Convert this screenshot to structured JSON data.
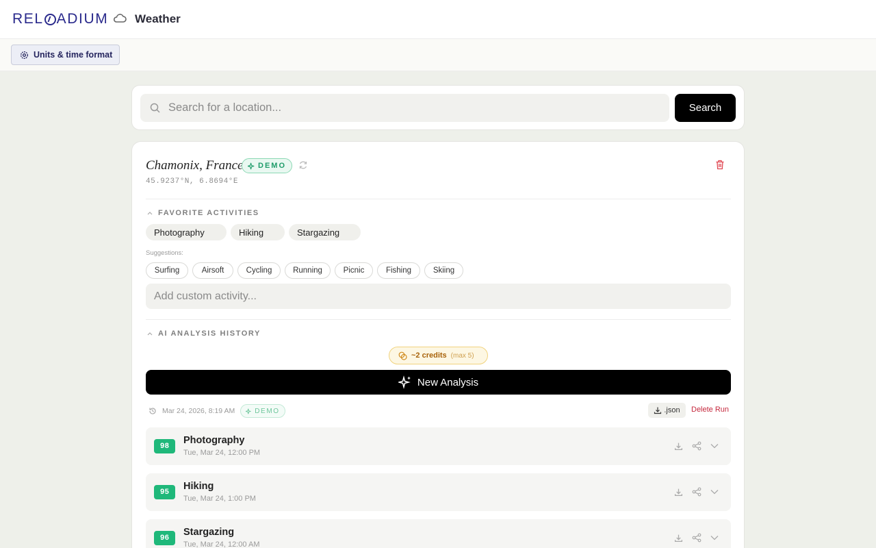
{
  "header": {
    "logo_text": "RELOADIUM",
    "app_title": "Weather",
    "app_icon": "cloud-icon"
  },
  "subbar": {
    "units_label": "Units & time format"
  },
  "search": {
    "placeholder": "Search for a location...",
    "button_label": "Search"
  },
  "location": {
    "name": "Chamonix, France",
    "badge": "DEMO",
    "coords": "45.9237°N, 6.8694°E"
  },
  "favorites": {
    "heading": "FAVORITE ACTIVITIES",
    "items": [
      "Photography",
      "Hiking",
      "Stargazing"
    ],
    "suggestions_label": "Suggestions:",
    "suggestions": [
      "Surfing",
      "Airsoft",
      "Cycling",
      "Running",
      "Picnic",
      "Fishing",
      "Skiing"
    ],
    "custom_placeholder": "Add custom activity..."
  },
  "analysis": {
    "heading": "AI ANALYSIS HISTORY",
    "credits": "~2 credits",
    "credits_max": "(max 5)",
    "new_label": "New Analysis",
    "run_timestamp": "Mar 24, 2026, 8:19 AM",
    "run_badge": "DEMO",
    "json_label": ".json",
    "delete_label": "Delete Run",
    "results": [
      {
        "score": "98",
        "title": "Photography",
        "time": "Tue, Mar 24, 12:00 PM"
      },
      {
        "score": "95",
        "title": "Hiking",
        "time": "Tue, Mar 24, 1:00 PM"
      },
      {
        "score": "96",
        "title": "Stargazing",
        "time": "Tue, Mar 24, 12:00 AM"
      }
    ]
  },
  "colors": {
    "accent": "#1fb87a",
    "brand": "#2a2a8c",
    "danger": "#c5283d"
  }
}
